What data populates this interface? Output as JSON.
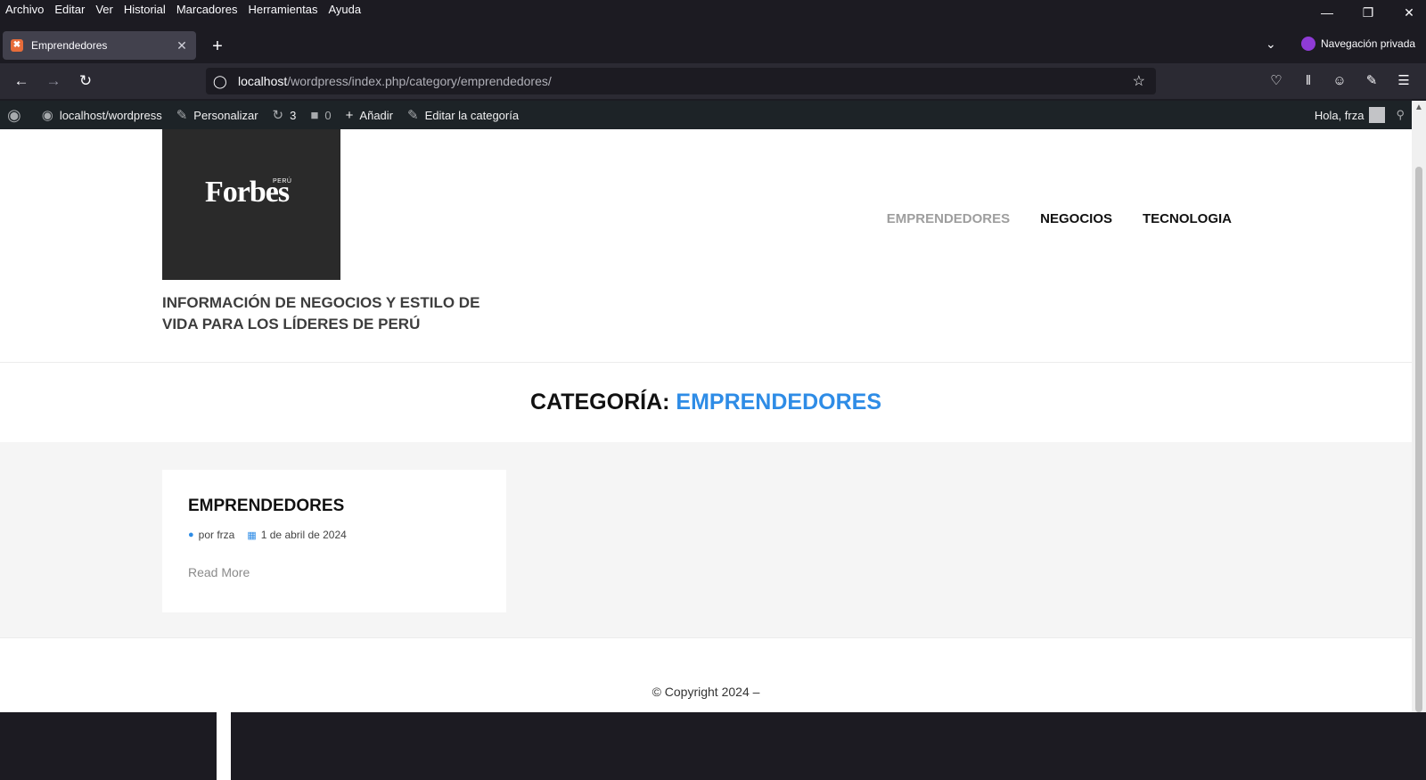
{
  "menubar": {
    "items": [
      "Archivo",
      "Editar",
      "Ver",
      "Historial",
      "Marcadores",
      "Herramientas",
      "Ayuda"
    ]
  },
  "window": {
    "minimize_icon": "minimize-icon",
    "restore_icon": "restore-icon",
    "close_icon": "close-icon"
  },
  "tabs": {
    "active_title": "Emprendedores",
    "private_label": "Navegación privada"
  },
  "navbar": {
    "url_host": "localhost",
    "url_path": "/wordpress/index.php/category/emprendedores/"
  },
  "adminbar": {
    "site": "localhost/wordpress",
    "customize": "Personalizar",
    "updates": "3",
    "comments": "0",
    "add_new": "Añadir",
    "edit_category": "Editar la categoría",
    "greeting": "Hola, frza"
  },
  "site": {
    "logo_text": "Forbes",
    "logo_sub": "PERÚ",
    "tagline": "INFORMACIÓN DE NEGOCIOS Y ESTILO DE VIDA PARA LOS LÍDERES DE PERÚ",
    "nav": [
      "EMPRENDEDORES",
      "NEGOCIOS",
      "TECNOLOGIA"
    ]
  },
  "archive": {
    "prefix": "CATEGORÍA: ",
    "category": "EMPRENDEDORES"
  },
  "post": {
    "title": "EMPRENDEDORES",
    "author": "por frza",
    "date": "1 de abril de 2024",
    "read_more": "Read More"
  },
  "footer": {
    "copyright": "© Copyright 2024 –"
  },
  "colors": {
    "accent": "#2e8ce6",
    "admin_bar": "#1d2327",
    "browser_chrome": "#1c1b22"
  }
}
